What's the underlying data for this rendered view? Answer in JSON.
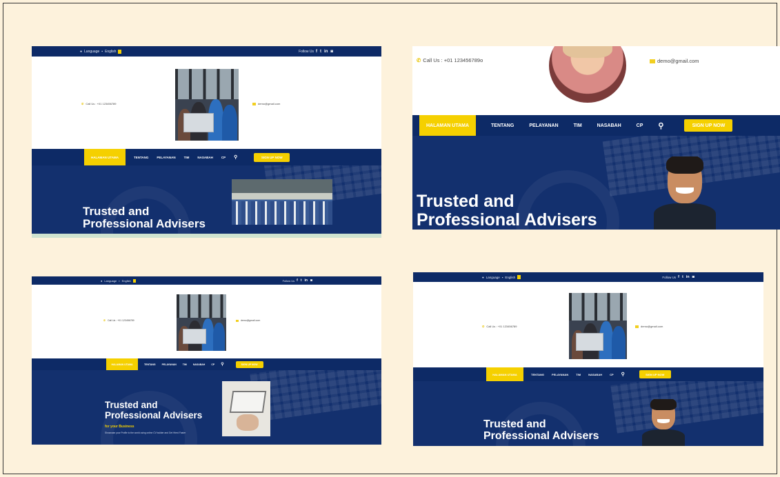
{
  "common": {
    "language_label": "Language",
    "language_value": "English",
    "follow_label": "Follow Us",
    "social_icons": [
      "facebook-icon",
      "twitter-icon",
      "linkedin-icon",
      "instagram-icon"
    ],
    "call_label": "Call Us : +01 123456789",
    "call_label_top_right": "Call Us : +01 123456789o",
    "email_value": "demo@gmail.com",
    "nav_items": [
      "HALAMAN UTAMA",
      "TENTANG",
      "PELAYANAN",
      "TIM",
      "NASABAH",
      "CP"
    ],
    "cta_label": "SIGN UP NOW",
    "hero_line1": "Trusted and",
    "hero_line2": "Professional Advisers",
    "hero_sub": "for your Business",
    "hero_desc": "Showcase your Profile to the world using online CV builder and Get Hired Faster"
  },
  "colors": {
    "navy": "#0d2a66",
    "hero_navy": "#13306e",
    "accent_yellow": "#f5d000",
    "page_background": "#fdf2dc"
  }
}
